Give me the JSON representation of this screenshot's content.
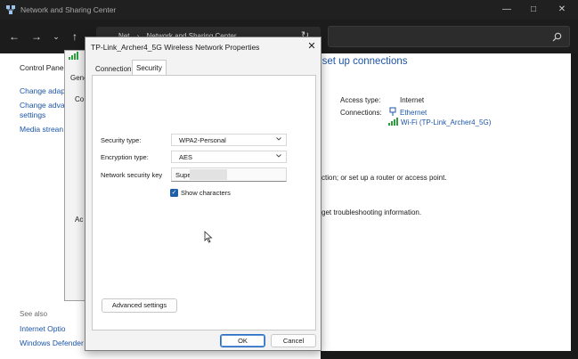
{
  "background_window": {
    "title": "Network and Sharing Center",
    "address_parts": [
      "Net",
      "›",
      "Network and Sharing Center"
    ],
    "left_links": [
      "Control Pane",
      "Change adap",
      "Change adva",
      "settings",
      "Media strean"
    ],
    "see_also_heading": "See also",
    "see_also_links": [
      "Internet Optio",
      "Windows Defender"
    ],
    "main_heading_fragment": "d set up connections",
    "access_type_label": "Access type:",
    "access_type_value": "Internet",
    "connections_label": "Connections:",
    "connection_ethernet": "Ethernet",
    "connection_wifi": "Wi-Fi (TP-Link_Archer4_5G)",
    "text_fragment_1": "ction; or set up a router or access point.",
    "text_fragment_2": "get troubleshooting information.",
    "accent_color": "#1b55a8"
  },
  "status_dialog": {
    "tab_fragment": "Gene",
    "fragment_co": "Co",
    "fragment_ac": "Ac"
  },
  "dialog": {
    "title": "TP-Link_Archer4_5G Wireless Network Properties",
    "tabs": [
      {
        "label": "Connection",
        "active": false
      },
      {
        "label": "Security",
        "active": true
      }
    ],
    "security_type_label": "Security type:",
    "security_type_value": "WPA2-Personal",
    "encryption_type_label": "Encryption type:",
    "encryption_type_value": "AES",
    "network_key_label": "Network security key",
    "network_key_value": "Supe",
    "show_characters_label": "Show characters",
    "show_characters_checked": true,
    "advanced_button": "Advanced settings",
    "ok_button": "OK",
    "cancel_button": "Cancel",
    "primary_color": "#1f5fa8"
  }
}
